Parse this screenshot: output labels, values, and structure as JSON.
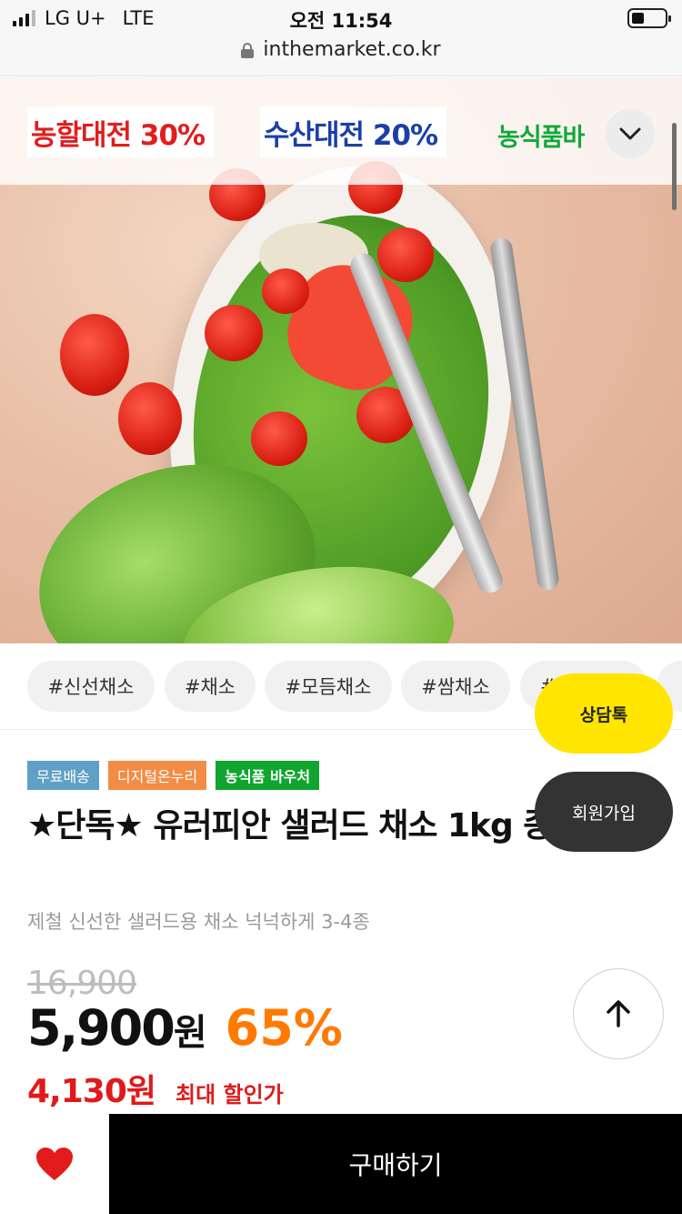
{
  "status_bar": {
    "carrier": "LG U+",
    "network": "LTE",
    "time": "오전 11:54",
    "battery_level": 0.3
  },
  "browser": {
    "url": "inthemarket.co.kr",
    "icon": "lock-icon"
  },
  "category_banner": {
    "items": [
      "농할대전 30%",
      "수산대전 20%",
      "농식품바"
    ],
    "colors": [
      "#e11d1d",
      "#1b3fa6",
      "#10a83a"
    ],
    "expand_icon": "chevron-down-icon"
  },
  "tags": [
    "#신선채소",
    "#채소",
    "#모듬채소",
    "#쌈채소",
    "#"
  ],
  "product": {
    "badges": [
      "무료배송",
      "디지털온누리",
      "농식품 바우처"
    ],
    "title": "★단독★ 유러피안 샐러드 채소 1kg 종",
    "subtitle": "제철 신선한 샐러드용 채소 넉넉하게 3-4종",
    "original_price": "16,900",
    "price": "5,900",
    "currency": "원",
    "discount": "65%",
    "max_discount_price": "4,130원",
    "max_discount_label": "최대 할인가"
  },
  "floating": {
    "kakao_label": "상담톡",
    "join_label": "회원가입",
    "top_icon": "arrow-up-icon"
  },
  "bottom_bar": {
    "wish_icon": "heart-icon",
    "buy_label": "구매하기"
  },
  "colors": {
    "accent_orange": "#ff7a00",
    "sale_red": "#e01a1a",
    "kakao_yellow": "#ffe500"
  }
}
